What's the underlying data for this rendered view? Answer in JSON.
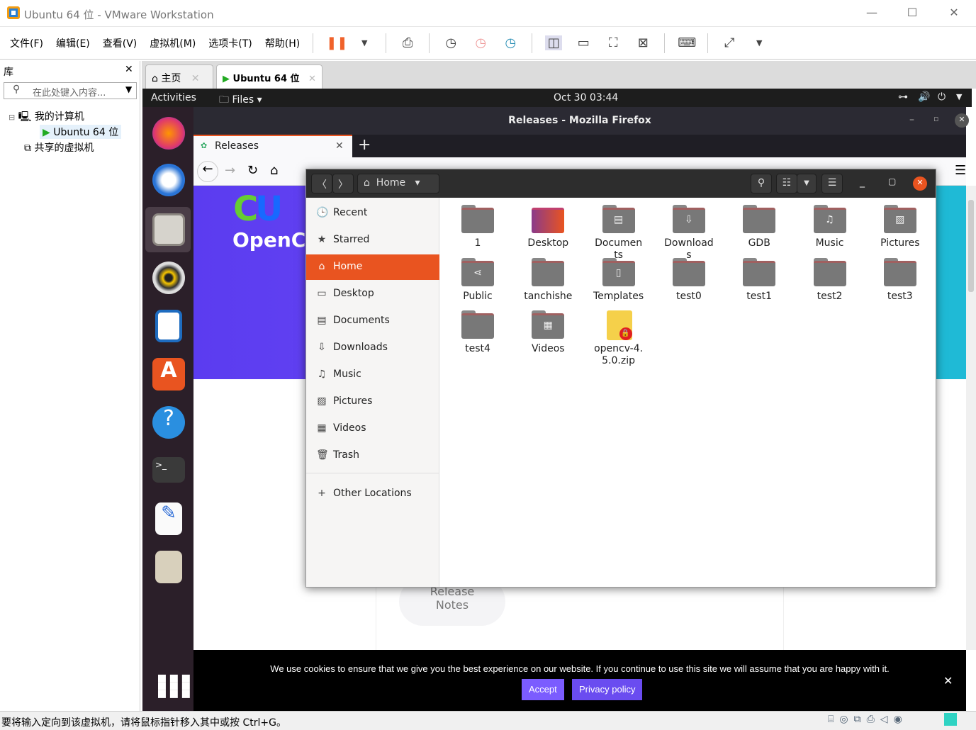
{
  "window": {
    "title": "Ubuntu 64 位 - VMware Workstation",
    "minimize": "—",
    "maximize": "☐",
    "close": "✕"
  },
  "menu": [
    "文件(F)",
    "编辑(E)",
    "查看(V)",
    "虚拟机(M)",
    "选项卡(T)",
    "帮助(H)"
  ],
  "library": {
    "title": "库",
    "close": "✕",
    "search_placeholder": "在此处键入内容...",
    "tree": [
      {
        "label": "我的计算机"
      },
      {
        "label": "Ubuntu 64 位"
      },
      {
        "label": "共享的虚拟机"
      }
    ]
  },
  "vm_tabs": [
    {
      "label": "主页"
    },
    {
      "label": "Ubuntu 64 位"
    }
  ],
  "ubuntu_top": {
    "activities": "Activities",
    "app": "Files",
    "clock": "Oct 30  03:44"
  },
  "firefox": {
    "title": "Releases - Mozilla Firefox",
    "tab": "Releases",
    "logo_text": "OpenCV",
    "release_notes": "Release Notes",
    "cookie": {
      "text": "We use cookies to ensure that we give you the best experience on our website. If you continue to use this site we will assume that you are happy with it.",
      "accept": "Accept",
      "privacy": "Privacy policy",
      "close": "✕"
    }
  },
  "files": {
    "location": "Home",
    "sidebar": [
      {
        "label": "Recent",
        "icon": "clock-icon",
        "g": "🕒"
      },
      {
        "label": "Starred",
        "icon": "star-icon",
        "g": "★"
      },
      {
        "label": "Home",
        "icon": "home-icon",
        "g": "⌂",
        "active": true
      },
      {
        "label": "Desktop",
        "icon": "desktop-icon",
        "g": "▭"
      },
      {
        "label": "Documents",
        "icon": "document-icon",
        "g": "▤"
      },
      {
        "label": "Downloads",
        "icon": "download-icon",
        "g": "⇩"
      },
      {
        "label": "Music",
        "icon": "music-icon",
        "g": "♫"
      },
      {
        "label": "Pictures",
        "icon": "picture-icon",
        "g": "▨"
      },
      {
        "label": "Videos",
        "icon": "video-icon",
        "g": "▦"
      },
      {
        "label": "Trash",
        "icon": "trash-icon",
        "g": "🗑"
      }
    ],
    "other_locations": "Other Locations",
    "items": [
      {
        "label": "1",
        "g": ""
      },
      {
        "label": "Desktop",
        "g": "",
        "type": "desktop"
      },
      {
        "label": "Documents",
        "g": "▤"
      },
      {
        "label": "Downloads",
        "g": "⇩"
      },
      {
        "label": "GDB",
        "g": ""
      },
      {
        "label": "Music",
        "g": "♫"
      },
      {
        "label": "Pictures",
        "g": "▨"
      },
      {
        "label": "Public",
        "g": "⋖"
      },
      {
        "label": "tanchishe",
        "g": ""
      },
      {
        "label": "Templates",
        "g": "▯"
      },
      {
        "label": "test0",
        "g": ""
      },
      {
        "label": "test1",
        "g": ""
      },
      {
        "label": "test2",
        "g": ""
      },
      {
        "label": "test3",
        "g": ""
      },
      {
        "label": "test4",
        "g": ""
      },
      {
        "label": "Videos",
        "g": "▦"
      },
      {
        "label": "opencv-4.5.0.zip",
        "g": "",
        "type": "zip"
      }
    ]
  },
  "status": {
    "text": "要将输入定向到该虚拟机，请将鼠标指针移入其中或按 Ctrl+G。"
  },
  "colors": {
    "accent": "#e95420",
    "pause": "#f0622b",
    "cookie_button": "#7b5cff"
  }
}
